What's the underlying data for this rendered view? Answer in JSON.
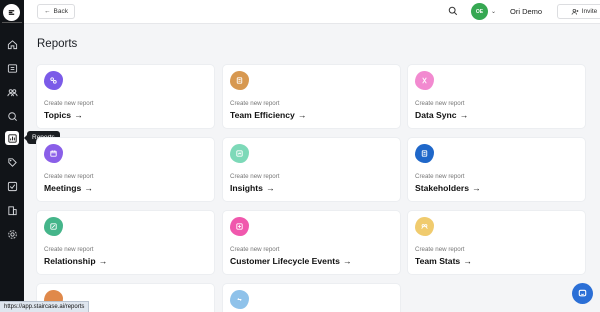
{
  "header": {
    "back_label": "Back",
    "avatar_initials": "OE",
    "org_name": "Ori Demo",
    "invite_label": "Invite"
  },
  "sidebar": {
    "tooltip": "Reports",
    "items": [
      "home-icon",
      "contacts-icon",
      "people-icon",
      "search-insights-icon",
      "reports-icon",
      "tags-icon",
      "checkbox-icon",
      "building-icon",
      "settings-icon"
    ]
  },
  "page": {
    "title": "Reports"
  },
  "cards": [
    {
      "create": "Create new report",
      "name": "Topics",
      "color": "#7b5be8"
    },
    {
      "create": "Create new report",
      "name": "Team Efficiency",
      "color": "#d79850"
    },
    {
      "create": "Create new report",
      "name": "Data Sync",
      "color": "#f28ad0"
    },
    {
      "create": "Create new report",
      "name": "Meetings",
      "color": "#8a5fe8"
    },
    {
      "create": "Create new report",
      "name": "Insights",
      "color": "#7dd9b8"
    },
    {
      "create": "Create new report",
      "name": "Stakeholders",
      "color": "#1f67c9"
    },
    {
      "create": "Create new report",
      "name": "Relationship",
      "color": "#45b58a"
    },
    {
      "create": "Create new report",
      "name": "Customer Lifecycle Events",
      "color": "#f058ad"
    },
    {
      "create": "Create new report",
      "name": "Team Stats",
      "color": "#f0cb6e"
    }
  ],
  "status_url": "https://app.staircase.ai/reports"
}
